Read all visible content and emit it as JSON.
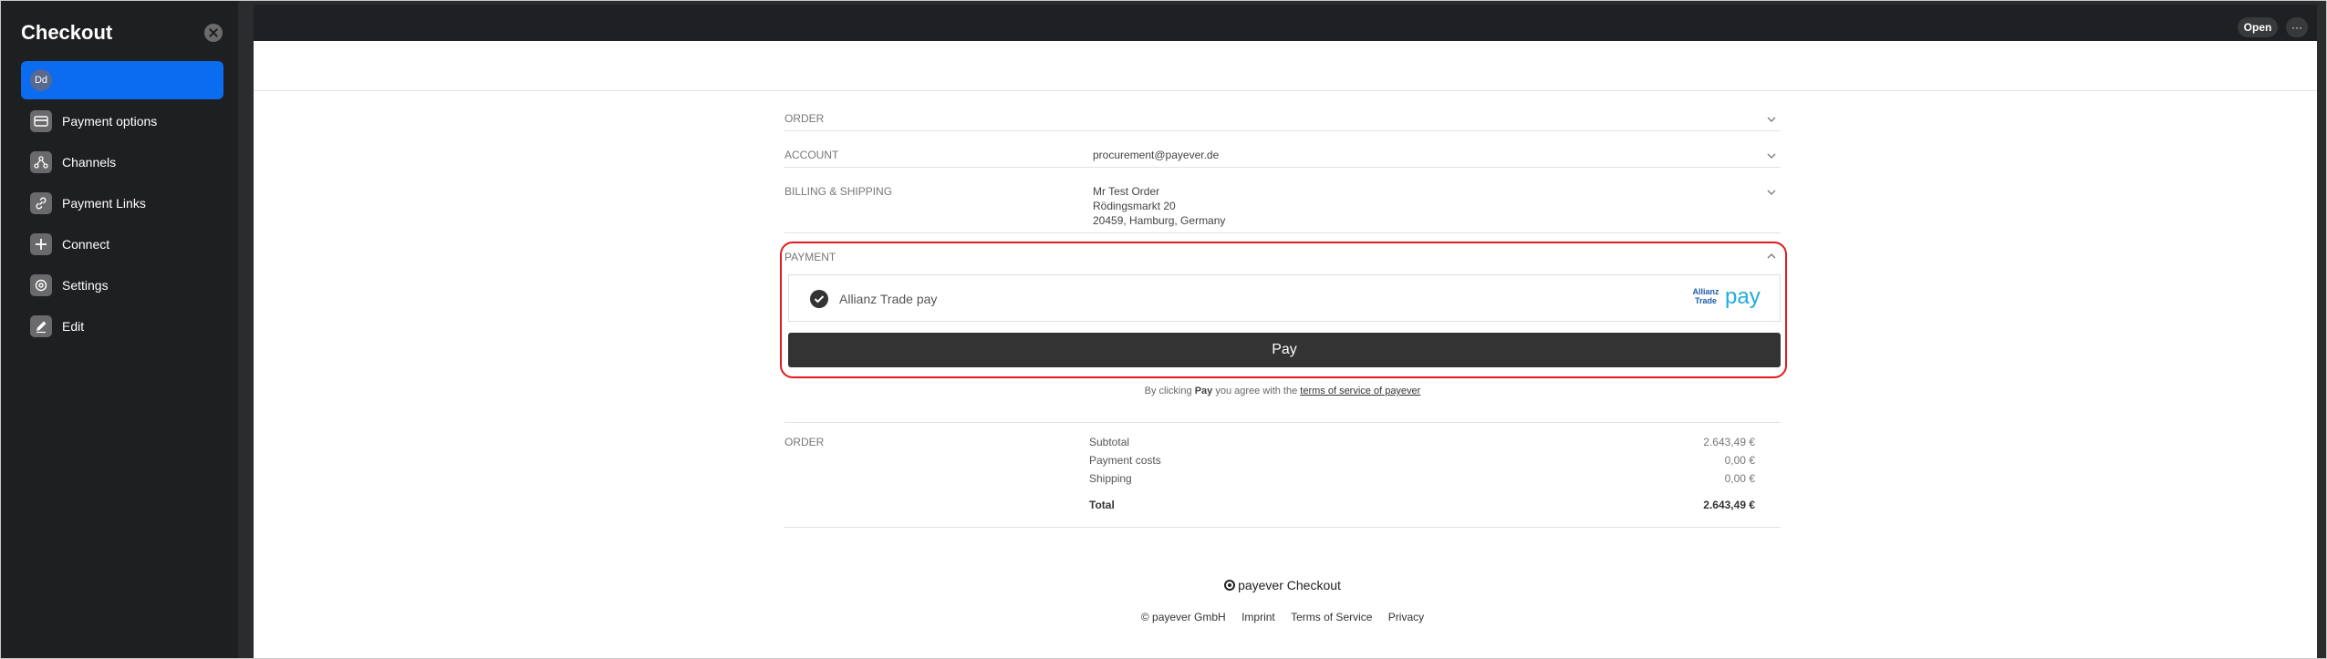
{
  "sidebar": {
    "title": "Checkout",
    "avatar_initials": "Dd",
    "items": [
      {
        "label": "Payment options",
        "icon": "card-icon"
      },
      {
        "label": "Channels",
        "icon": "channels-icon"
      },
      {
        "label": "Payment Links",
        "icon": "link-icon"
      },
      {
        "label": "Connect",
        "icon": "plus-icon"
      },
      {
        "label": "Settings",
        "icon": "gear-icon"
      },
      {
        "label": "Edit",
        "icon": "pencil-icon"
      }
    ]
  },
  "topbar": {
    "open_label": "Open",
    "more_label": "···"
  },
  "checkout": {
    "order": {
      "label": "ORDER"
    },
    "account": {
      "label": "ACCOUNT",
      "email": "procurement@payever.de"
    },
    "billing": {
      "label": "BILLING & SHIPPING",
      "name": "Mr Test Order",
      "street": "Rödingsmarkt 20",
      "city": "20459, Hamburg, Germany"
    },
    "payment": {
      "label": "PAYMENT",
      "method_label": "Allianz Trade pay",
      "logo_small_line1": "Allianz",
      "logo_small_line2": "Trade",
      "logo_pay": "pay",
      "pay_button": "Pay",
      "terms_prefix": "By clicking",
      "terms_bold": "Pay",
      "terms_middle": "you agree with the",
      "terms_link": "terms of service of payever"
    },
    "summary": {
      "label": "ORDER",
      "rows": [
        {
          "label": "Subtotal",
          "amount": "2.643,49 €"
        },
        {
          "label": "Payment costs",
          "amount": "0,00 €"
        },
        {
          "label": "Shipping",
          "amount": "0,00 €"
        }
      ],
      "total_label": "Total",
      "total_amount": "2.643,49 €"
    }
  },
  "footer": {
    "brand_name": "payever",
    "brand_product": "Checkout",
    "links": [
      "© payever GmbH",
      "Imprint",
      "Terms of Service",
      "Privacy"
    ]
  },
  "colors": {
    "accent": "#0b6cef",
    "highlight": "#e1191e",
    "pay_button": "#333333"
  }
}
